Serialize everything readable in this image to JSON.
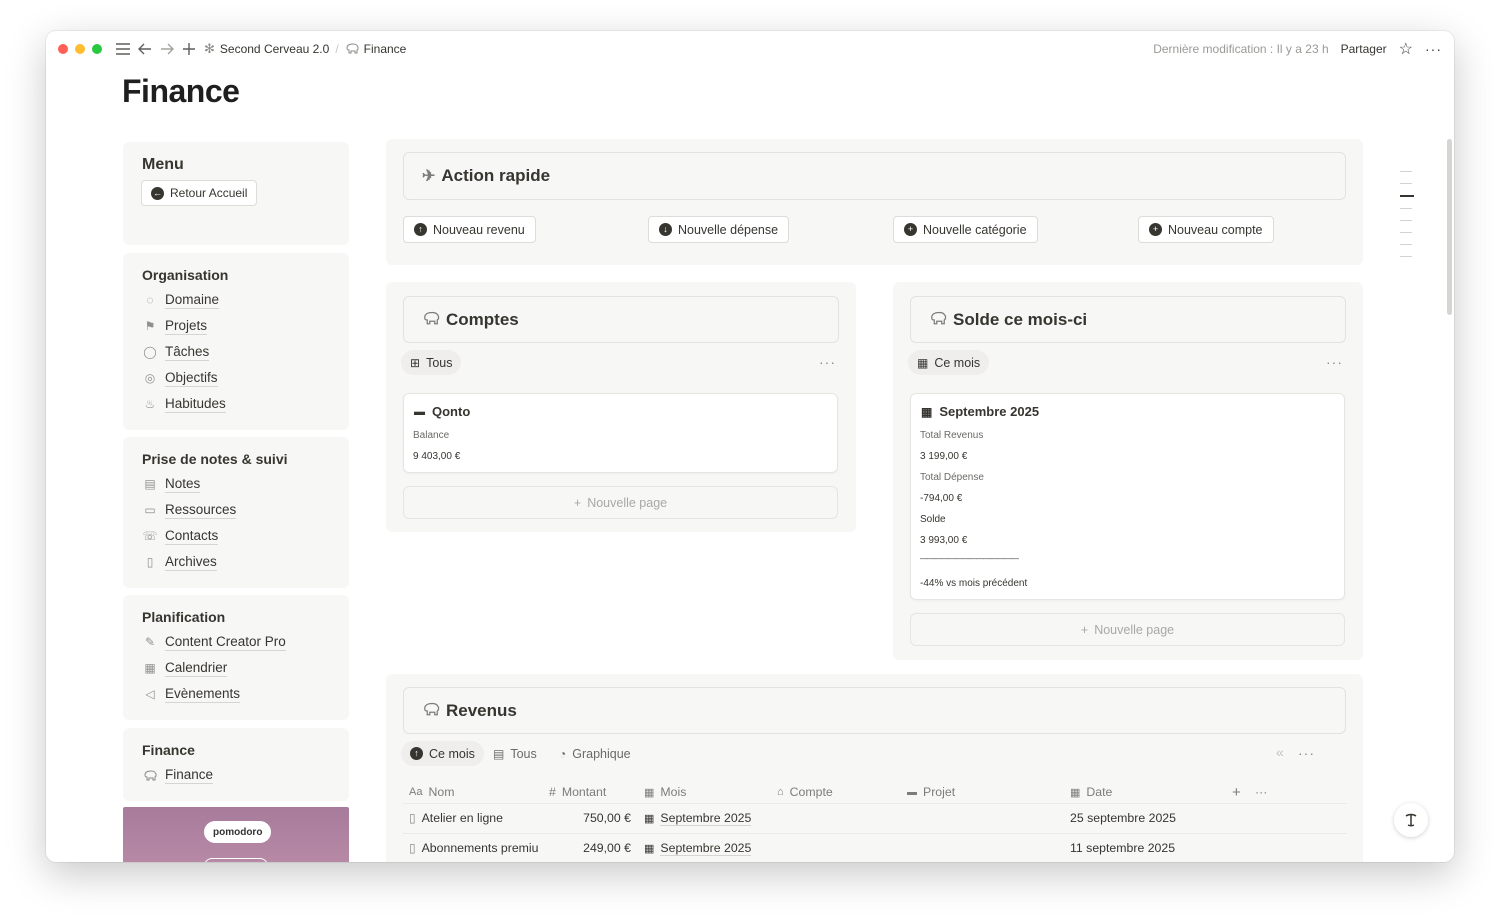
{
  "topbar": {
    "colors": {
      "red": "#ff5f57",
      "yellow": "#febc2e",
      "green": "#28c840"
    },
    "crumbs": [
      "Second Cerveau 2.0",
      "Finance"
    ],
    "last_modified": "Dernière modification : Il y a 23 h",
    "share": "Partager"
  },
  "page": {
    "title": "Finance"
  },
  "sidebar": {
    "menu": {
      "title": "Menu",
      "home_button": "Retour Accueil"
    },
    "organisation": {
      "title": "Organisation",
      "items": [
        "Domaine",
        "Projets",
        "Tâches",
        "Objectifs",
        "Habitudes"
      ]
    },
    "notes": {
      "title": "Prise de notes & suivi",
      "items": [
        "Notes",
        "Ressources",
        "Contacts",
        "Archives"
      ]
    },
    "planification": {
      "title": "Planification",
      "items": [
        "Content Creator Pro",
        "Calendrier",
        "Evènements"
      ]
    },
    "finance": {
      "title": "Finance",
      "items": [
        "Finance"
      ]
    },
    "pomodoro": "pomodoro"
  },
  "quick_actions": {
    "title": "Action rapide",
    "buttons": [
      "Nouveau revenu",
      "Nouvelle dépense",
      "Nouvelle catégorie",
      "Nouveau compte"
    ]
  },
  "accounts": {
    "title": "Comptes",
    "view": "Tous",
    "card": {
      "name": "Qonto",
      "balance_label": "Balance",
      "balance_value": "9 403,00 €"
    },
    "new_page": "Nouvelle page"
  },
  "balance_month": {
    "title": "Solde ce mois-ci",
    "view": "Ce mois",
    "card": {
      "name": "Septembre 2025",
      "total_revenue_label": "Total Revenus",
      "total_revenue_value": "3 199,00 €",
      "total_expense_label": "Total Dépense",
      "total_expense_value": "-794,00 €",
      "balance_label": "Solde",
      "balance_value": "3 993,00 €",
      "divider": "——————————————",
      "comparison": "-44% vs mois précédent"
    },
    "new_page": "Nouvelle page"
  },
  "revenues": {
    "title": "Revenus",
    "views": [
      "Ce mois",
      "Tous",
      "Graphique"
    ],
    "columns": [
      "Nom",
      "Montant",
      "Mois",
      "Compte",
      "Projet",
      "Date"
    ],
    "column_icons": [
      "Aa",
      "#"
    ],
    "rows": [
      {
        "nom": "Atelier en ligne",
        "montant": "750,00 €",
        "mois": "Septembre 2025",
        "compte": "",
        "projet": "",
        "date": "25 septembre 2025"
      },
      {
        "nom": "Abonnements premiu",
        "montant": "249,00 €",
        "mois": "Septembre 2025",
        "compte": "",
        "projet": "",
        "date": "11 septembre 2025"
      }
    ]
  }
}
